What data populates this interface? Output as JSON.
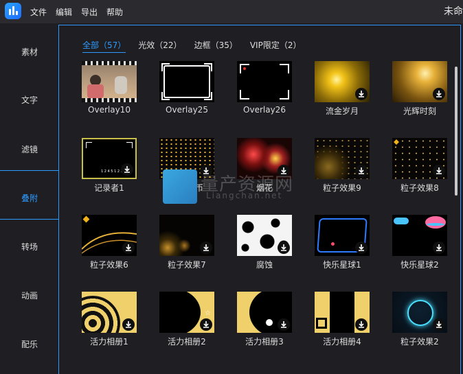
{
  "menu": [
    "文件",
    "编辑",
    "导出",
    "帮助"
  ],
  "window_title": "未命",
  "sidebar": [
    "素材",
    "文字",
    "滤镜",
    "叠附",
    "转场",
    "动画",
    "配乐"
  ],
  "sidebar_active": "叠附",
  "tabs": [
    {
      "label": "全部（57）",
      "active": true
    },
    {
      "label": "光效（22）",
      "active": false
    },
    {
      "label": "边框（35）",
      "active": false
    },
    {
      "label": "VIP限定（2）",
      "active": false
    }
  ],
  "overlays": [
    {
      "label": "Overlay10",
      "downloaded": true
    },
    {
      "label": "Overlay25",
      "downloaded": true
    },
    {
      "label": "Overlay26",
      "downloaded": true
    },
    {
      "label": "流金岁月",
      "downloaded": false
    },
    {
      "label": "光辉时刻",
      "downloaded": false
    },
    {
      "label": "记录者1",
      "downloaded": false
    },
    {
      "label": "漫天金币",
      "downloaded": false
    },
    {
      "label": "烟花",
      "downloaded": false
    },
    {
      "label": "粒子效果9",
      "downloaded": false
    },
    {
      "label": "粒子效果8",
      "downloaded": false
    },
    {
      "label": "粒子效果6",
      "downloaded": false
    },
    {
      "label": "粒子效果7",
      "downloaded": false
    },
    {
      "label": "腐蚀",
      "downloaded": false
    },
    {
      "label": "快乐星球1",
      "downloaded": false
    },
    {
      "label": "快乐星球2",
      "downloaded": false
    },
    {
      "label": "活力相册1",
      "downloaded": false
    },
    {
      "label": "活力相册2",
      "downloaded": false
    },
    {
      "label": "活力相册3",
      "downloaded": false
    },
    {
      "label": "活力相册4",
      "downloaded": false
    },
    {
      "label": "粒子效果2",
      "downloaded": false
    }
  ],
  "watermark": {
    "text": "量产资源网",
    "url": "Liangchan.net"
  },
  "colors": {
    "accent": "#2d9bff",
    "bg": "#1f1f23",
    "topbar": "#2a2a2f"
  }
}
